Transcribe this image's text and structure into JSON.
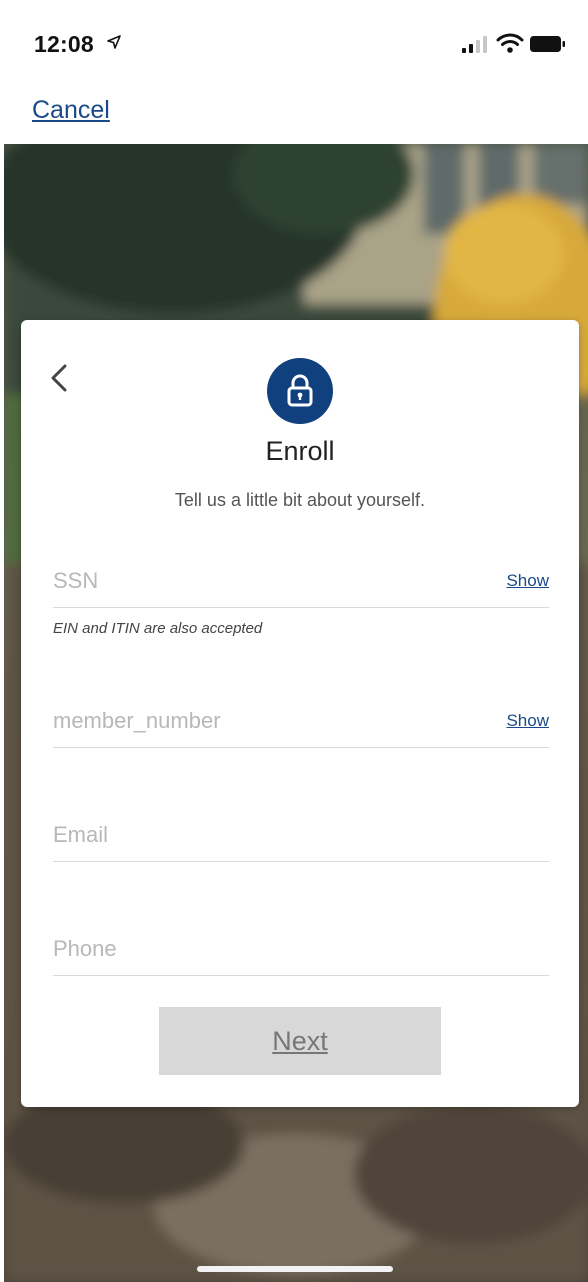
{
  "status_bar": {
    "time": "12:08",
    "icons": [
      "location-arrow-icon",
      "cellular-signal-icon",
      "wifi-icon",
      "battery-icon"
    ]
  },
  "nav": {
    "cancel_label": "Cancel"
  },
  "card": {
    "back_icon": "chevron-left-icon",
    "lock_icon": "lock-icon",
    "title": "Enroll",
    "subtitle": "Tell us a little bit about yourself."
  },
  "form": {
    "ssn": {
      "placeholder": "SSN",
      "value": "",
      "toggle_label": "Show",
      "hint": "EIN and ITIN are also accepted"
    },
    "member_number": {
      "placeholder": "member_number",
      "value": "",
      "toggle_label": "Show"
    },
    "email": {
      "placeholder": "Email",
      "value": ""
    },
    "phone": {
      "placeholder": "Phone",
      "value": ""
    },
    "next_label": "Next"
  },
  "colors": {
    "accent": "#10407e",
    "link": "#1b4a8a",
    "button_disabled": "#d8d8d8"
  }
}
